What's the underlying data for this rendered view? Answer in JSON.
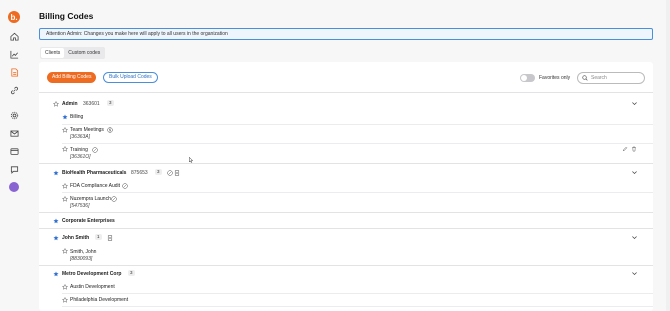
{
  "sidebar": {
    "logo": "b.",
    "icons": [
      "home-icon",
      "chart-icon",
      "document-icon",
      "link-icon",
      "gear-icon",
      "mail-icon",
      "wallet-icon",
      "chat-icon",
      "avatar"
    ]
  },
  "page": {
    "title": "Billing Codes",
    "notice": "Attention Admin: Changes you make here will apply to all users in the organization"
  },
  "tabs": [
    {
      "label": "Clients",
      "active": true
    },
    {
      "label": "Custom codes",
      "active": false
    }
  ],
  "toolbar": {
    "add_label": "Add Billing Codes",
    "bulk_label": "Bulk Upload Codes",
    "favorites_label": "Favorites only",
    "search_placeholder": "Search"
  },
  "clients": [
    {
      "name": "Admin",
      "code": "363601",
      "count": "3",
      "starred": false,
      "children": [
        {
          "name": "Billing",
          "starred": true,
          "code": ""
        },
        {
          "name": "Team Meetings",
          "starred": false,
          "code": "[36363A]"
        },
        {
          "name": "Training",
          "starred": false,
          "code": "[36361O]"
        }
      ]
    },
    {
      "name": "BioHealth Pharmaceuticals",
      "code": "875653",
      "count": "3",
      "starred": true,
      "children": [
        {
          "name": "FDA Compliance Audit",
          "starred": false,
          "code": ""
        },
        {
          "name": "Nuzempra Launch",
          "starred": false,
          "code": "[547536]"
        }
      ]
    },
    {
      "name": "Corporate Enterprises",
      "code": "",
      "count": "",
      "starred": true,
      "children": []
    },
    {
      "name": "John Smith",
      "code": "",
      "count": "1",
      "starred": true,
      "children": [
        {
          "name": "Smith, John",
          "starred": false,
          "code": "[8830093]"
        }
      ]
    },
    {
      "name": "Metro Development Corp",
      "code": "",
      "count": "3",
      "starred": true,
      "children": [
        {
          "name": "Austin Development",
          "starred": false,
          "code": ""
        },
        {
          "name": "Philadelphia Development",
          "starred": false,
          "code": ""
        }
      ]
    }
  ],
  "colors": {
    "accent": "#ee6b22",
    "star_blue": "#2f6fd0",
    "notice_border": "#4a8fd9"
  }
}
